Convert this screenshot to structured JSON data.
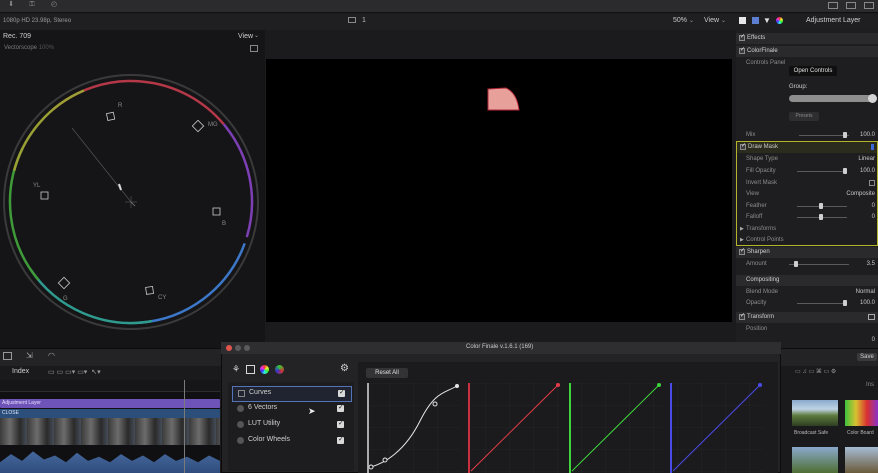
{
  "topbar": {
    "format": "1080p HD 23.98p, Stereo",
    "zoom": "50%",
    "view": "View",
    "clip_index": "1",
    "inspector_title": "Adjustment Layer"
  },
  "scope": {
    "preset": "Rec. 709",
    "view": "View",
    "name": "Vectorscope",
    "pct": "100%",
    "targets": [
      "R",
      "MG",
      "B",
      "CY",
      "G",
      "YL"
    ]
  },
  "inspector": {
    "effects": "Effects",
    "colorfinale": "ColorFinale",
    "controls_panel": "Controls Panel",
    "open_controls": "Open Controls",
    "group": "Group:",
    "presets": "Presets",
    "mix": "Mix",
    "mix_val": "100.0",
    "draw_mask": "Draw Mask",
    "shape_type": "Shape Type",
    "shape_type_val": "Linear",
    "fill_opacity": "Fill Opacity",
    "fill_opacity_val": "100.0",
    "invert_mask": "Invert Mask",
    "view": "View",
    "view_val": "Composite",
    "feather": "Feather",
    "feather_val": "0",
    "falloff": "Falloff",
    "falloff_val": "0",
    "transforms": "Transforms",
    "control_points": "Control Points",
    "sharpen": "Sharpen",
    "amount": "Amount",
    "amount_val": "3.5",
    "compositing": "Compositing",
    "blend_mode": "Blend Mode",
    "blend_mode_val": "Normal",
    "opacity": "Opacity",
    "opacity_val": "100.0",
    "transform": "Transform",
    "position": "Position",
    "save": "Save"
  },
  "timeline": {
    "index": "Index",
    "clip_label": "Adjustment Layer",
    "clip2_label": "CLOSE"
  },
  "colorfinale": {
    "title": "Color Finale v.1.6.1 (169)",
    "reset_all": "Reset All",
    "tools": [
      "Curves",
      "6 Vectors",
      "LUT Utility",
      "Color Wheels"
    ],
    "curve_colors": [
      "#e6e6e6",
      "#e33c48",
      "#3fd43c",
      "#4a4ae8"
    ]
  },
  "browser": {
    "thumb1": "Broadcast Safe",
    "thumb2": "Color Board"
  }
}
